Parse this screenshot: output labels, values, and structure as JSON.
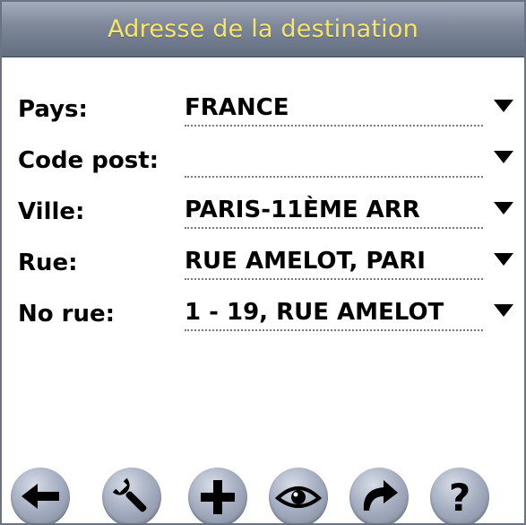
{
  "header": {
    "title": "Adresse de la destination"
  },
  "form": {
    "rows": [
      {
        "label": "Pays:",
        "value": "FRANCE"
      },
      {
        "label": "Code post:",
        "value": ""
      },
      {
        "label": "Ville:",
        "value": "PARIS-11ÈME ARR"
      },
      {
        "label": "Rue:",
        "value": "RUE AMELOT, PARI"
      },
      {
        "label": "No rue:",
        "value": "1 - 19, RUE AMELOT"
      }
    ]
  },
  "toolbar": {
    "buttons": [
      {
        "icon": "back-arrow-icon"
      },
      {
        "icon": "wrench-icon"
      },
      {
        "icon": "plus-icon"
      },
      {
        "icon": "eye-icon"
      },
      {
        "icon": "redo-arrow-icon"
      },
      {
        "icon": "help-icon",
        "glyph": "?"
      }
    ]
  },
  "colors": {
    "title_text": "#f7e46a",
    "title_bar": "#7d8799",
    "button": "#a7b0c2",
    "icon": "#000000"
  }
}
